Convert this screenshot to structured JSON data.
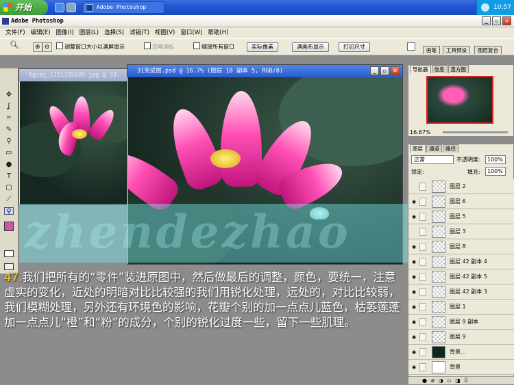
{
  "taskbar": {
    "start": "开始",
    "task": "Adobe Photoshop",
    "clock": "10:57"
  },
  "app": {
    "title": "Adobe Photoshop"
  },
  "menu": [
    "文件(F)",
    "编辑(E)",
    "图像(I)",
    "图层(L)",
    "选择(S)",
    "滤镜(T)",
    "视图(V)",
    "窗口(W)",
    "帮助(H)"
  ],
  "options": {
    "resize_window": "调整窗口大小以满屏显示",
    "ignore_palettes": "忽略调板",
    "zoom_all": "缩放所有窗口",
    "actual_pixels": "实际像素",
    "fit_screen": "满画布显示",
    "print_size": "打印尺寸",
    "palette_tabs": [
      "画笔",
      "工具预设",
      "图层复合"
    ]
  },
  "doc_back": {
    "title": "tgsaj_1151335028.jpg @ 33."
  },
  "doc_front": {
    "title": "31完成图.psd @ 16.7% (图层 18 副本 5, RGB/8)"
  },
  "watermark": "zhendezhao",
  "navigator": {
    "tabs": [
      "导航器",
      "信息",
      "直方图"
    ],
    "zoom": "16.67%"
  },
  "layers": {
    "tabs": [
      "图层",
      "通道",
      "路径"
    ],
    "blend_mode": "正常",
    "opacity_label": "不透明度:",
    "opacity": "100%",
    "lock_label": "锁定:",
    "fill_label": "填充:",
    "fill": "100%",
    "items": [
      {
        "name": "图层 2",
        "visible": false,
        "selected": false,
        "thumb": "trans"
      },
      {
        "name": "图层 6",
        "visible": true,
        "selected": false,
        "thumb": "trans"
      },
      {
        "name": "图层 5",
        "visible": true,
        "selected": false,
        "thumb": "trans"
      },
      {
        "name": "图层 3",
        "visible": false,
        "selected": false,
        "thumb": "trans"
      },
      {
        "name": "图层 8",
        "visible": true,
        "selected": false,
        "thumb": "trans"
      },
      {
        "name": "图层 42 副本 4",
        "visible": true,
        "selected": false,
        "thumb": "trans"
      },
      {
        "name": "图层 42 副本 5",
        "visible": true,
        "selected": false,
        "thumb": "trans"
      },
      {
        "name": "图层 42 副本 3",
        "visible": true,
        "selected": false,
        "thumb": "trans"
      },
      {
        "name": "图层 1",
        "visible": true,
        "selected": false,
        "thumb": "trans"
      },
      {
        "name": "图层 9 副本",
        "visible": true,
        "selected": false,
        "thumb": "trans"
      },
      {
        "name": "图层 9",
        "visible": true,
        "selected": false,
        "thumb": "trans"
      },
      {
        "name": "背景...",
        "visible": true,
        "selected": false,
        "thumb": "dark"
      },
      {
        "name": "背景",
        "visible": true,
        "selected": false,
        "thumb": "white"
      }
    ]
  },
  "caption": {
    "number": "47.",
    "text": "我们把所有的“零件”装进原图中，然后做最后的调整，颜色，要统一，注意虚实的变化，近处的明暗对比比较强的我们用锐化处理，远处的，对比比较弱，我们模糊处理，另外还有环境色的影响，花瓣个别的加一点点儿蓝色，枯萎莲蓬加一点点儿“橙”和“粉”的成分，个别的锐化过度一些，留下一些肌理。"
  },
  "colors": {
    "accent": "#2a5bd0",
    "caption": "#ffffff",
    "caption_number": "#f6d22a",
    "band": "#78e6eb"
  }
}
